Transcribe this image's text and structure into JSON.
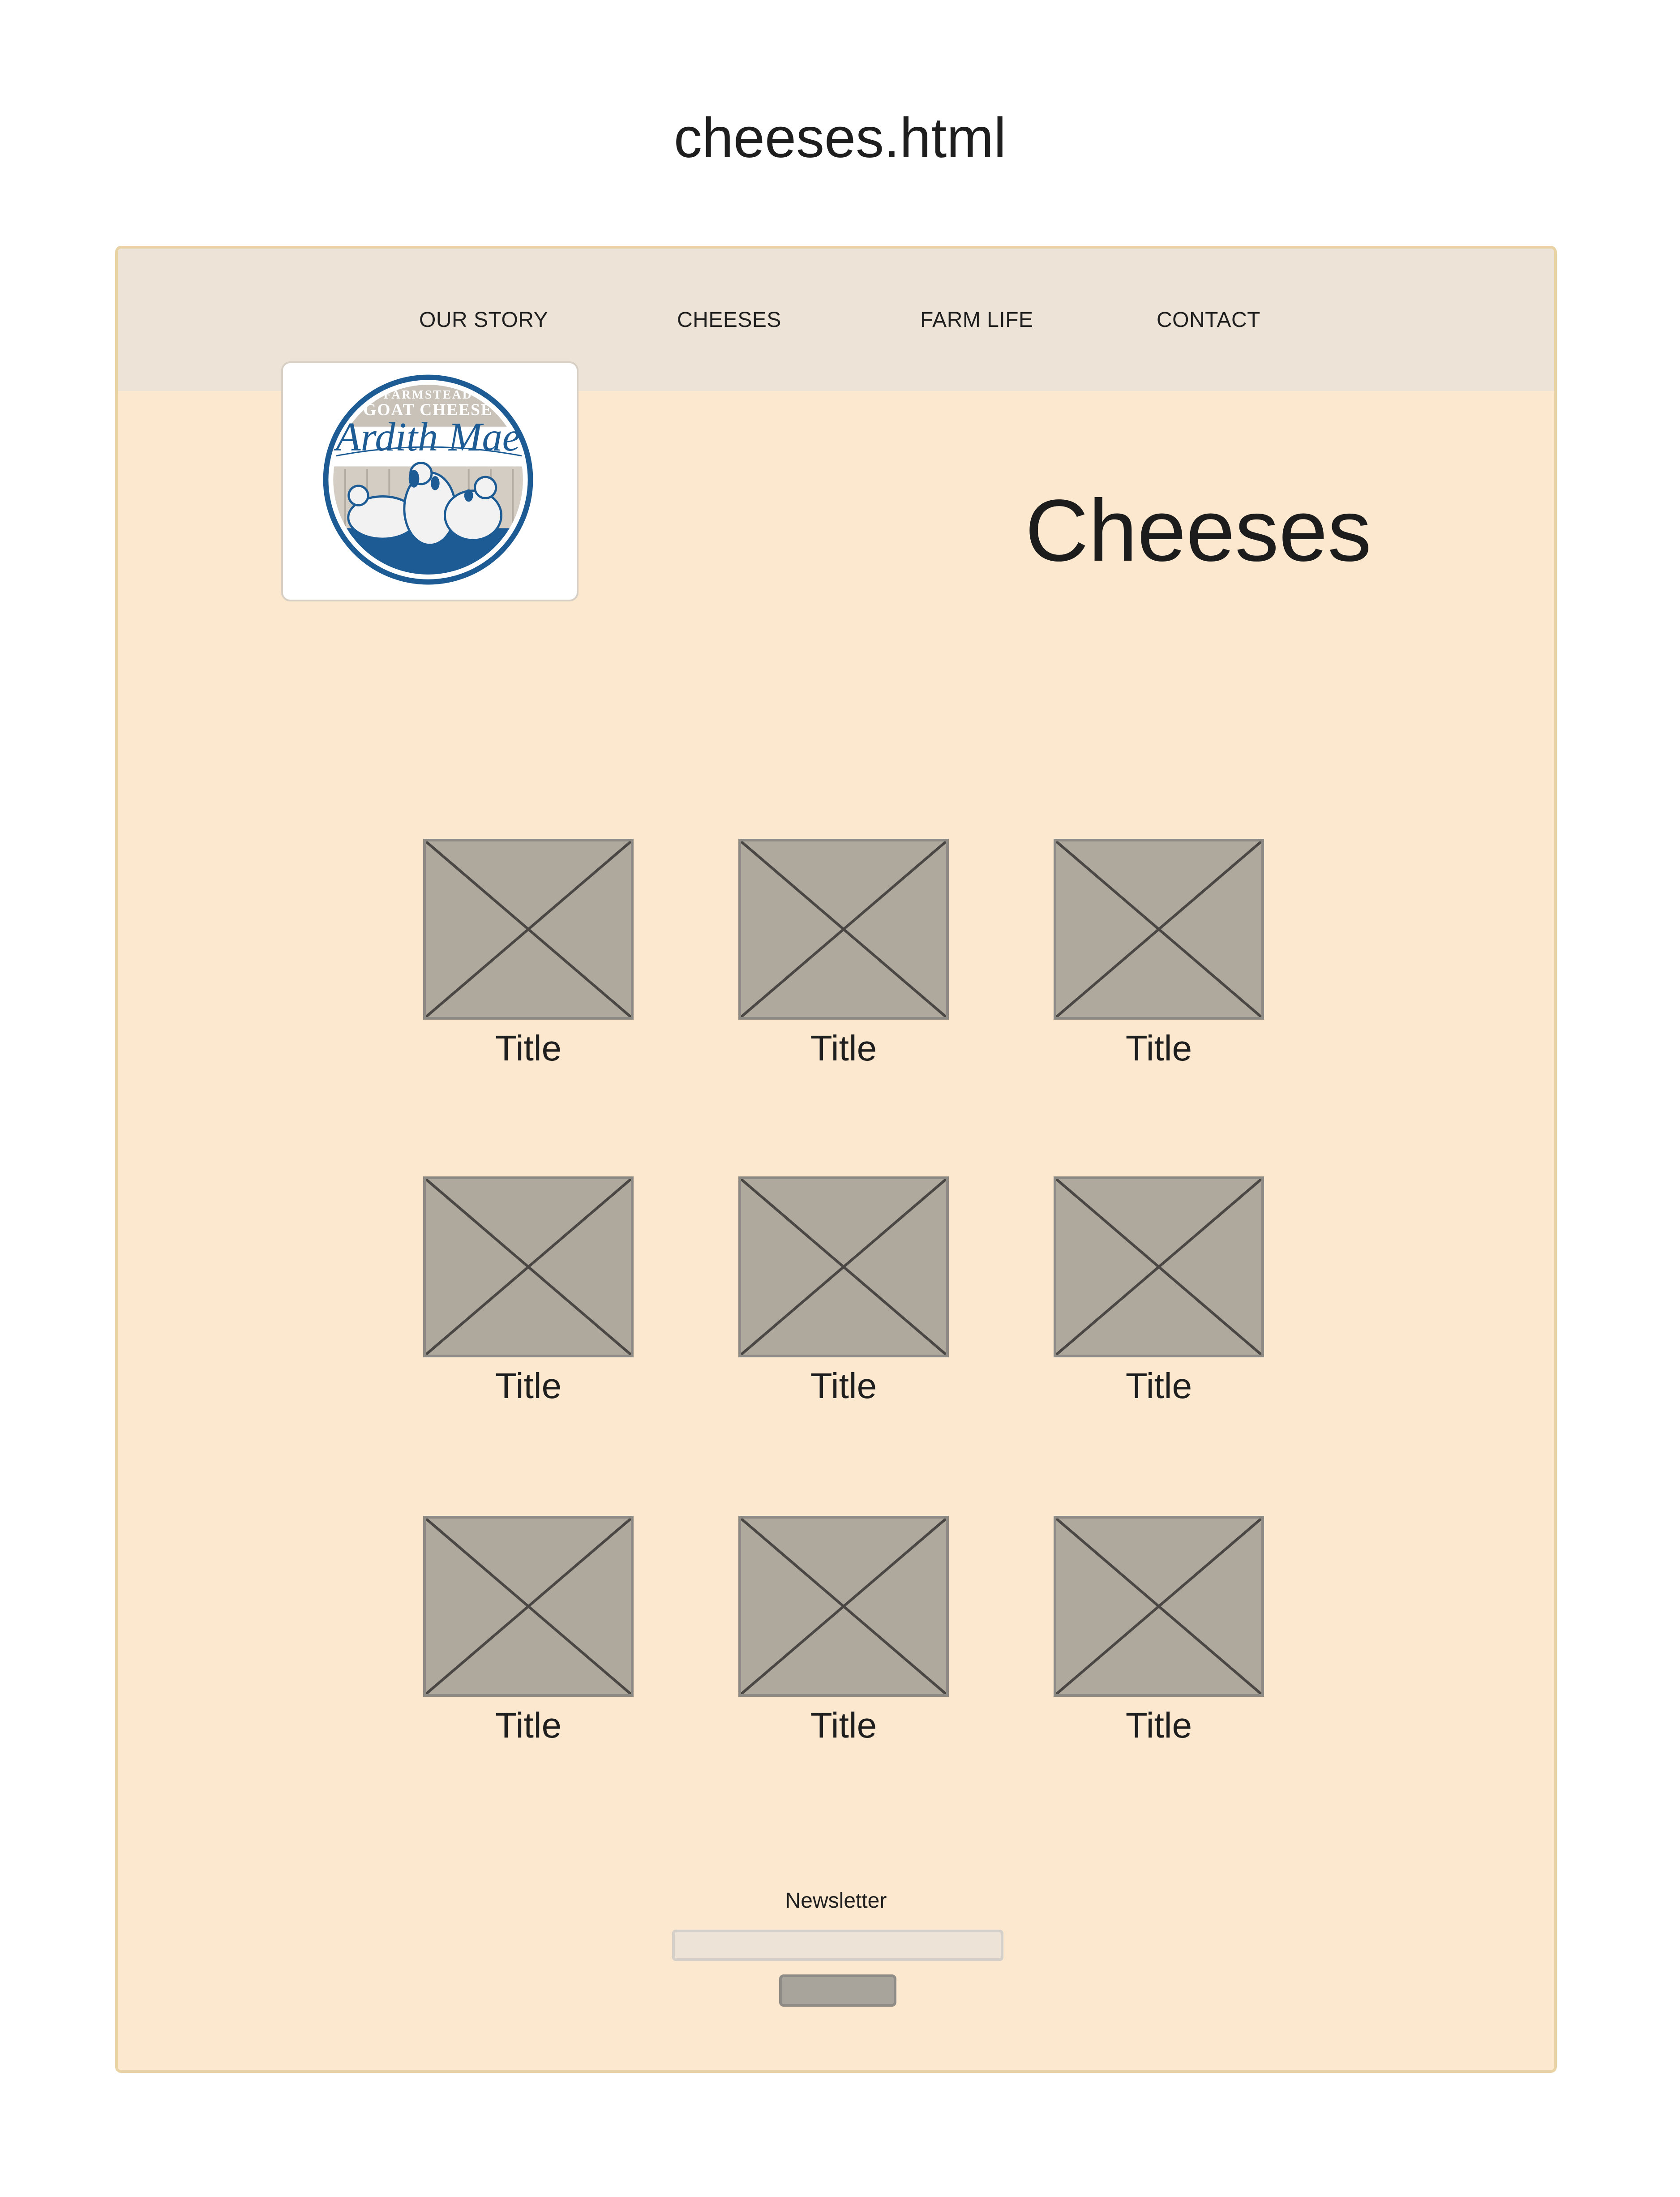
{
  "document_title": "cheeses.html",
  "nav": {
    "items": [
      {
        "label": "OUR STORY"
      },
      {
        "label": "CHEESES"
      },
      {
        "label": "FARM LIFE"
      },
      {
        "label": "CONTACT"
      }
    ]
  },
  "logo": {
    "icon": "goat-cheese-logo-icon",
    "text_top": "FARMSTEAD",
    "text_mid": "GOAT CHEESE",
    "text_brand": "Ardith Mae",
    "colors": {
      "ring": "#1d5b95",
      "band": "#b9b3ab"
    }
  },
  "page_heading": "Cheeses",
  "grid": {
    "items": [
      {
        "title": "Title"
      },
      {
        "title": "Title"
      },
      {
        "title": "Title"
      },
      {
        "title": "Title"
      },
      {
        "title": "Title"
      },
      {
        "title": "Title"
      },
      {
        "title": "Title"
      },
      {
        "title": "Title"
      },
      {
        "title": "Title"
      }
    ],
    "placeholder_icon": "image-placeholder-icon"
  },
  "newsletter": {
    "label": "Newsletter",
    "input_value": "",
    "button_label": ""
  },
  "colors": {
    "frame_bg": "#fbe8cf",
    "frame_border": "#e9d3a4",
    "nav_bg": "#ede3d6",
    "placeholder_fill": "#afa89d"
  }
}
